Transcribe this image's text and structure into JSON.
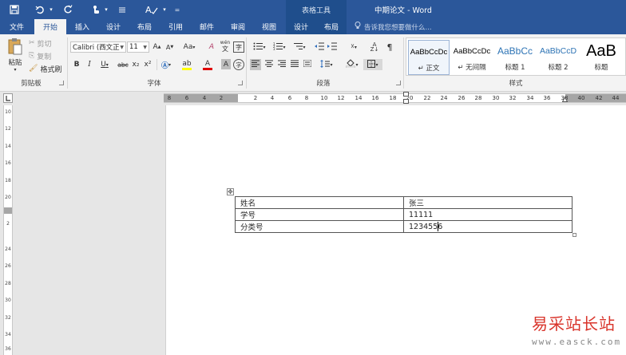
{
  "titlebar": {
    "save_icon": "save-icon",
    "undo_icon": "undo-icon",
    "redo_icon": "redo-icon",
    "touch_icon": "touch-mode-icon",
    "customize_icon": "customize-qat-icon",
    "contextual_group": "表格工具",
    "document_title": "中期论文 - Word"
  },
  "tabs": [
    {
      "label": "文件"
    },
    {
      "label": "开始"
    },
    {
      "label": "插入"
    },
    {
      "label": "设计"
    },
    {
      "label": "布局"
    },
    {
      "label": "引用"
    },
    {
      "label": "邮件"
    },
    {
      "label": "审阅"
    },
    {
      "label": "视图"
    },
    {
      "label": "设计"
    },
    {
      "label": "布局"
    }
  ],
  "tell_me": "告诉我您想要做什么...",
  "clipboard": {
    "paste": "粘贴",
    "cut": "剪切",
    "copy": "复制",
    "format_painter": "格式刷",
    "group_label": "剪贴板"
  },
  "font": {
    "family": "Calibri (西文正",
    "size": "11",
    "group_label": "字体",
    "grow": "A",
    "shrink": "A",
    "case": "Aa",
    "bold": "B",
    "italic": "I",
    "underline": "U",
    "strike": "abc",
    "subscript": "x₂",
    "superscript": "x²",
    "font_color_letter": "A",
    "char_shading": "A",
    "enclose": "字",
    "pinyin": "wén",
    "clear_format": "A"
  },
  "paragraph": {
    "group_label": "段落"
  },
  "styles": {
    "group_label": "样式",
    "items": [
      {
        "sample": "AaBbCcDc",
        "name": "↵ 正文"
      },
      {
        "sample": "AaBbCcDc",
        "name": "↵ 无间隔"
      },
      {
        "sample": "AaBbCc",
        "name": "标题 1"
      },
      {
        "sample": "AaBbCcD",
        "name": "标题 2"
      },
      {
        "sample": "AaB",
        "name": "标题"
      }
    ]
  },
  "ruler": {
    "left_ticks": [
      "8",
      "6",
      "4",
      "2"
    ],
    "right_ticks": [
      "2",
      "4",
      "6",
      "8",
      "10",
      "12",
      "14",
      "16",
      "18",
      "20",
      "22",
      "24",
      "26",
      "28",
      "30",
      "32",
      "34",
      "36",
      "38",
      "40",
      "42",
      "44"
    ],
    "vertical_ticks": [
      "10",
      "12",
      "14",
      "16",
      "18",
      "20",
      "2",
      "24",
      "26",
      "28",
      "30",
      "32",
      "34",
      "36"
    ]
  },
  "table": {
    "rows": [
      [
        "姓名",
        "张三"
      ],
      [
        "学号",
        "11111"
      ],
      [
        "分类号",
        "1234556"
      ]
    ]
  },
  "watermark": {
    "line1": "易采站长站",
    "line2": "www.easck.com"
  },
  "colors": {
    "title_bar": "#2b579a",
    "contextual": "#1f4e8c",
    "font_color_bar": "#e00000",
    "highlight_bar": "#ffff00",
    "watermark_red": "#d9342b"
  }
}
